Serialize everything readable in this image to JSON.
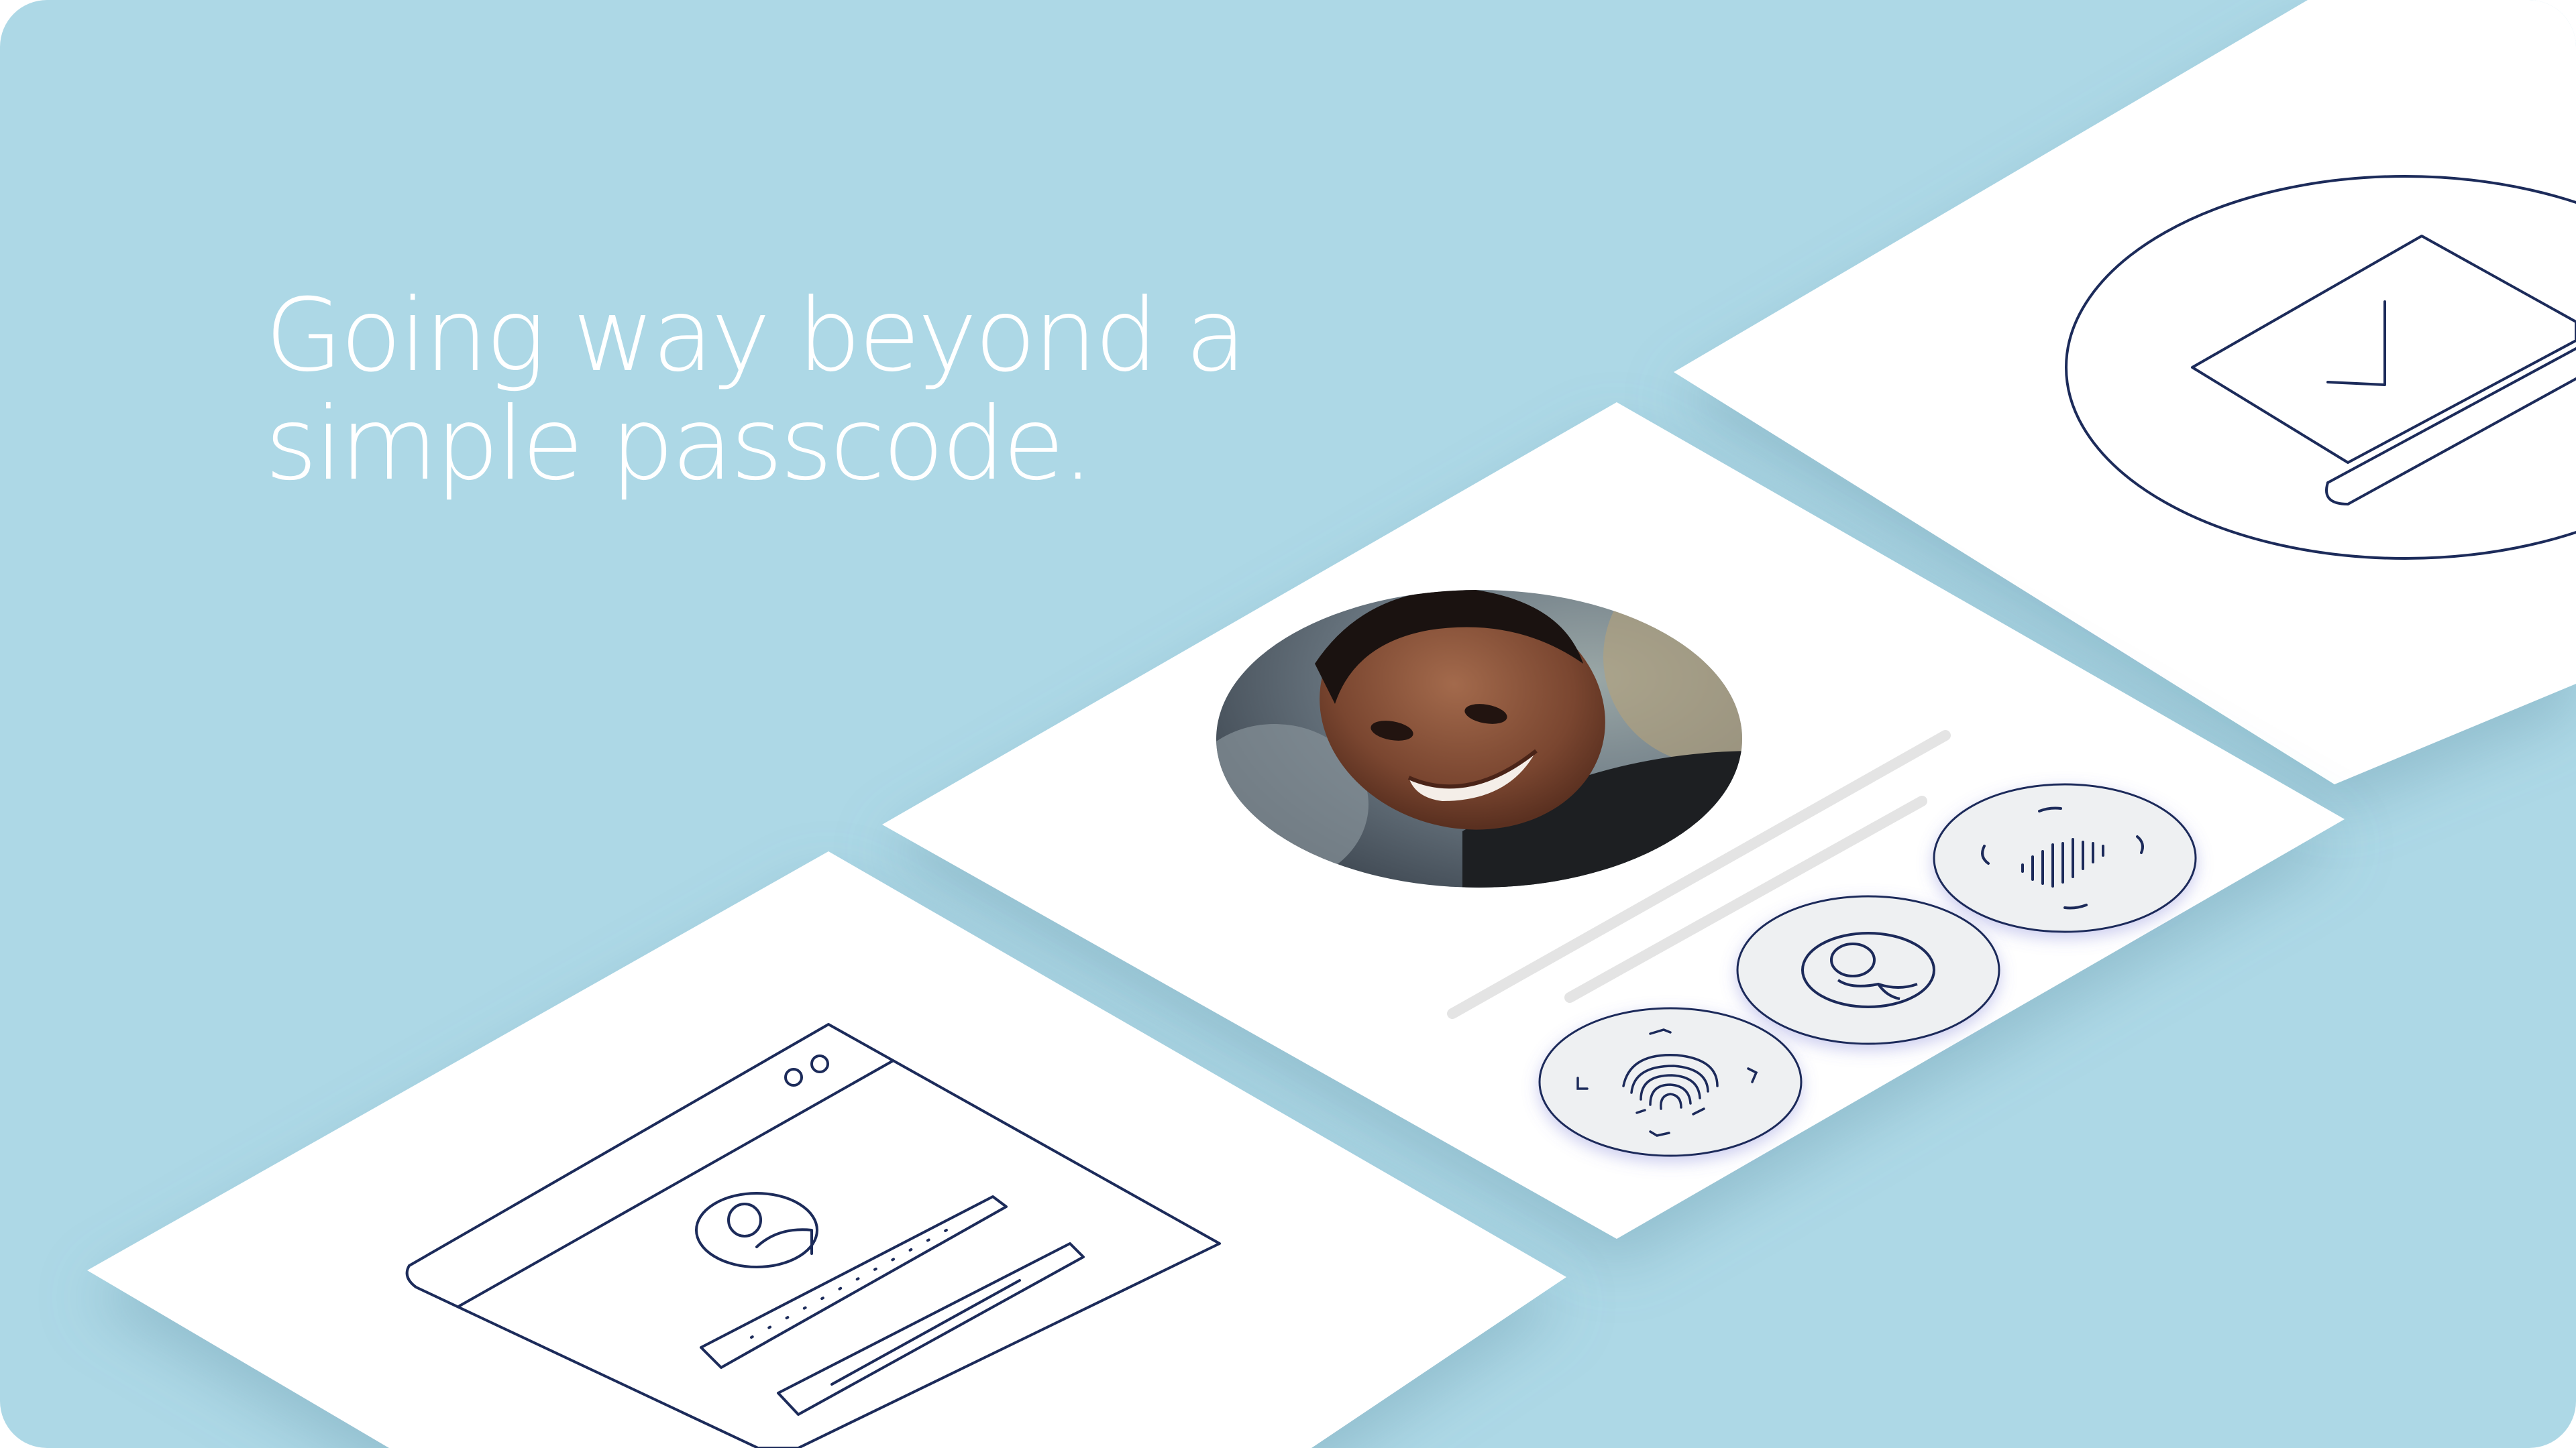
{
  "headline": {
    "line1": "Going way beyond a",
    "line2": "simple passcode."
  },
  "colors": {
    "background": "#add8e6",
    "card": "#ffffff",
    "line_art": "#1c2b5a",
    "button_fill": "#eef0f2",
    "placeholder_bar": "#e6e6e6"
  },
  "icons": {
    "browser_login": "browser-login-icon",
    "fingerprint": "fingerprint-icon",
    "face_recognition": "face-recognition-icon",
    "voice": "voice-waveform-icon",
    "verified_card": "verified-card-icon"
  }
}
